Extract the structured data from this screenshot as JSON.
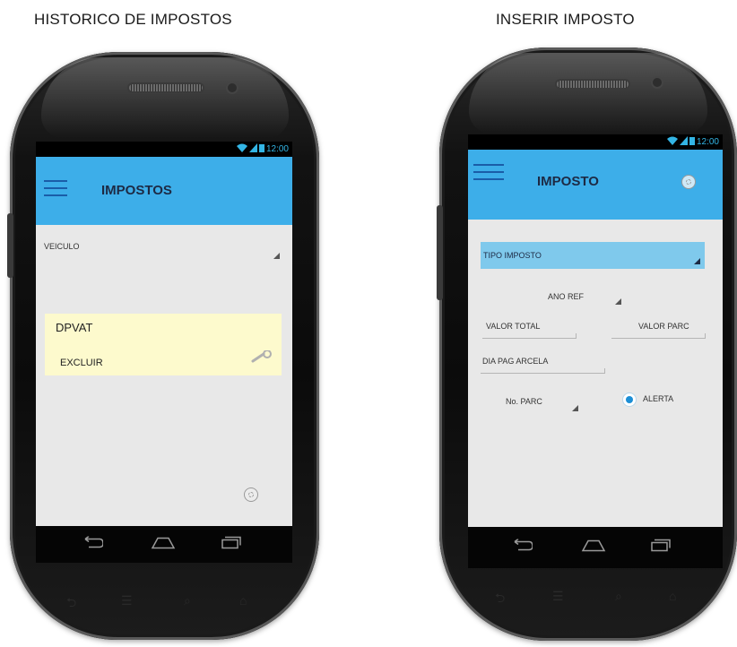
{
  "captions": {
    "left": "HISTORICO DE IMPOSTOS",
    "right": "INSERIR IMPOSTO"
  },
  "status_bar": {
    "time": "12:00"
  },
  "colors": {
    "appbar": "#3daee9",
    "card": "#fdfacd",
    "accent": "#1a5da8"
  },
  "left_screen": {
    "title": "IMPOSTOS",
    "veiculo_label": "VEICULO",
    "card": {
      "title": "DPVAT",
      "action": "EXCLUIR"
    },
    "icons": [
      "menu-icon",
      "wrench-icon",
      "gear-icon"
    ]
  },
  "right_screen": {
    "title": "IMPOSTO",
    "tipo_imposto": "TIPO IMPOSTO",
    "ano_ref": "ANO REF",
    "valor_total": "VALOR TOTAL",
    "valor_parc": "VALOR PARC",
    "dia_pag": "DIA PAG ARCELA",
    "num_parc": "No. PARC",
    "alerta": "ALERTA",
    "icons": [
      "menu-icon",
      "gear-icon",
      "radio-icon"
    ]
  },
  "nav_icons": [
    "back-icon",
    "home-icon",
    "recents-icon"
  ]
}
